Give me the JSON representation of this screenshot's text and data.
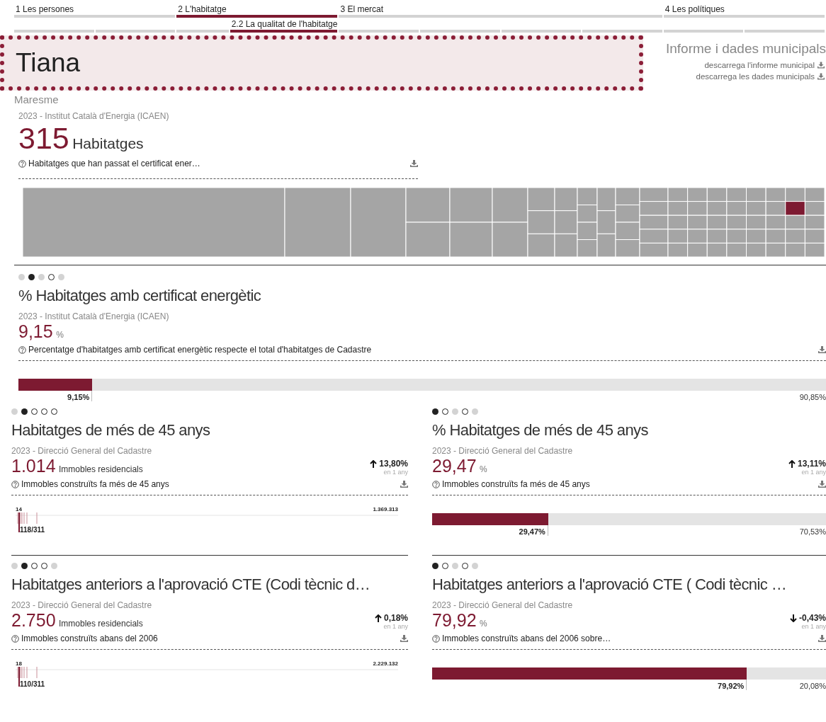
{
  "nav": [
    {
      "label": "1 Les persones",
      "selected": false,
      "subsections": [
        {
          "selected": false
        },
        {
          "selected": false
        }
      ]
    },
    {
      "label": "2 L'habitatge",
      "selected": true,
      "subsections": [
        {
          "selected": false
        },
        {
          "label": "2.2 La qualitat de l'habitatge",
          "selected": true
        }
      ]
    },
    {
      "label": "3 El mercat",
      "selected": false,
      "subsections": [
        {
          "selected": false
        },
        {
          "selected": false
        },
        {
          "selected": false
        },
        {
          "selected": false
        }
      ]
    },
    {
      "label": "4 Les polítiques",
      "selected": false,
      "subsections": [
        {
          "selected": false
        },
        {
          "selected": false
        }
      ]
    }
  ],
  "municipality": {
    "name": "Tiana",
    "region": "Maresme"
  },
  "downloads": {
    "title": "Informe i dades municipals",
    "links": [
      "descarrega l'informe municipal",
      "descarrega les dades municipals"
    ]
  },
  "cards": [
    {
      "kind": "treemap",
      "source": "2023 - Institut Català d'Energia (ICAEN)",
      "value": "315",
      "unit": "Habitatges",
      "description": "Habitatges que han passat el certificat ener…"
    },
    {
      "kind": "bar",
      "dots": [
        {
          "kind": "grey"
        },
        {
          "kind": "filled"
        },
        {
          "kind": "grey"
        },
        {
          "kind": "hollow"
        },
        {
          "kind": "grey"
        }
      ],
      "title": "% Habitatges amb certificat energètic",
      "source": "2023 - Institut Català d'Energia (ICAEN)",
      "value": "9,15",
      "unit": "%",
      "description": "Percentatge d'habitatges amb certificat energètic respecte el total d'habitatges de Cadastre",
      "level": 0.0915,
      "left_label": "9,15%",
      "right_label": "90,85%"
    },
    {
      "kind": "strip",
      "dots": [
        {
          "kind": "grey"
        },
        {
          "kind": "filled"
        },
        {
          "kind": "hollow"
        },
        {
          "kind": "hollow"
        },
        {
          "kind": "hollow"
        }
      ],
      "title": "Habitatges de més de 45 anys",
      "source": "2023 - Direcció General del Cadastre",
      "value": "1.014",
      "unit": "Immobles residencials",
      "trend": {
        "kind": "up",
        "value": "13,80%",
        "note": "en 1 any"
      },
      "description": "Immobles construïts fa més de 45 anys",
      "min": "14",
      "max": "1.369.313",
      "rank": "118/311"
    },
    {
      "kind": "bar",
      "dots": [
        {
          "kind": "filled"
        },
        {
          "kind": "hollow"
        },
        {
          "kind": "grey"
        },
        {
          "kind": "hollow"
        },
        {
          "kind": "grey"
        }
      ],
      "title": "% Habitatges de més de 45 anys",
      "source": "2023 - Direcció General del Cadastre",
      "value": "29,47",
      "unit": "%",
      "trend": {
        "kind": "up",
        "value": "13,11%",
        "note": "en 1 any"
      },
      "description": "Immobles construïts fa més de 45 anys",
      "level": 0.2947,
      "left_label": "29,47%",
      "right_label": "70,53%"
    },
    {
      "kind": "strip",
      "dots": [
        {
          "kind": "grey"
        },
        {
          "kind": "filled"
        },
        {
          "kind": "hollow"
        },
        {
          "kind": "hollow"
        },
        {
          "kind": "grey"
        }
      ],
      "title": "Habitatges anteriors a l'aprovació CTE (Codi tècnic d…",
      "source": "2023 - Direcció General del Cadastre",
      "value": "2.750",
      "unit": "Immobles residencials",
      "trend": {
        "kind": "up",
        "value": "0,18%",
        "note": "en 1 any"
      },
      "description": "Immobles construïts abans del 2006",
      "min": "18",
      "max": "2.229.132",
      "rank": "110/311"
    },
    {
      "kind": "bar",
      "dots": [
        {
          "kind": "filled"
        },
        {
          "kind": "hollow"
        },
        {
          "kind": "grey"
        },
        {
          "kind": "hollow"
        },
        {
          "kind": "grey"
        }
      ],
      "title": "Habitatges anteriors a l'aprovació CTE ( Codi tècnic …",
      "source": "2023 - Direcció General del Cadastre",
      "value": "79,92",
      "unit": "%",
      "trend": {
        "kind": "down",
        "value": "-0,43%",
        "note": "en 1 any"
      },
      "description": "Immobles construïts abans del 2006 sobre…",
      "level": 0.7992,
      "left_label": "79,92%",
      "right_label": "20,08%"
    }
  ]
}
